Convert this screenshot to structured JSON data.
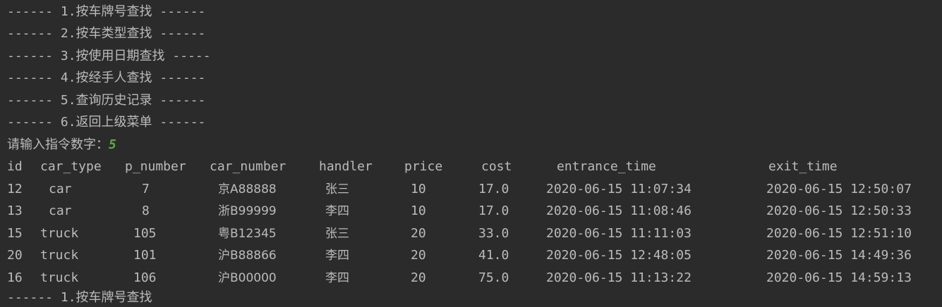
{
  "menu": [
    "------ 1.按车牌号查找 ------",
    "------ 2.按车类型查找 ------",
    "------ 3.按使用日期查找 -----",
    "------ 4.按经手人查找 ------",
    "------ 5.查询历史记录 ------",
    "------ 6.返回上级菜单 ------"
  ],
  "prompt": {
    "label": "请输入指令数字：",
    "input": "5"
  },
  "table": {
    "headers": [
      "id",
      "car_type",
      "p_number",
      "car_number",
      "handler",
      "price",
      "cost",
      "entrance_time",
      "exit_time"
    ],
    "rows": [
      [
        "12",
        "car",
        "7",
        "京A88888",
        "张三",
        "10",
        "17.0",
        "2020-06-15 11:07:34",
        "2020-06-15 12:50:07"
      ],
      [
        "13",
        "car",
        "8",
        "浙B99999",
        "李四",
        "10",
        "17.0",
        "2020-06-15 11:08:46",
        "2020-06-15 12:50:33"
      ],
      [
        "15",
        "truck",
        "105",
        "粤B12345",
        "张三",
        "20",
        "33.0",
        "2020-06-15 11:11:03",
        "2020-06-15 12:51:10"
      ],
      [
        "20",
        "truck",
        "101",
        "沪B88866",
        "李四",
        "20",
        "41.0",
        "2020-06-15 12:48:05",
        "2020-06-15 14:49:36"
      ],
      [
        "16",
        "truck",
        "106",
        "沪B00000",
        "李四",
        "20",
        "75.0",
        "2020-06-15 11:13:22",
        "2020-06-15 14:59:13"
      ]
    ]
  },
  "partial_line": "------ 1.按车牌号查找",
  "colors": {
    "background": "#2b2b2b",
    "text": "#bbbbbb",
    "user_input": "#62a744"
  }
}
